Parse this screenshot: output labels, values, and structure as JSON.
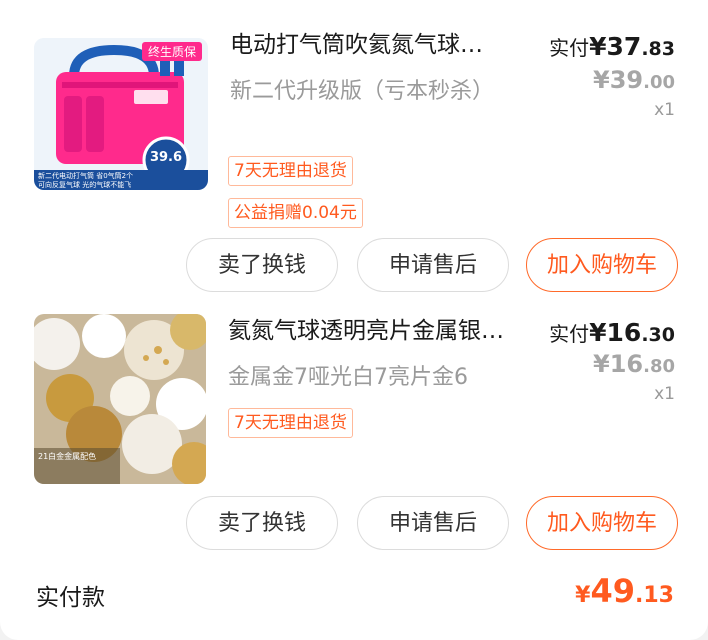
{
  "orders": [
    {
      "title": "电动打气筒吹氦氮气球…",
      "spec": "新二代升级版（亏本秒杀）",
      "tags": [
        "7天无理由退货",
        "公益捐赠0.04元"
      ],
      "paid_label": "实付",
      "paid_yen": "¥37",
      "paid_cent": ".83",
      "orig_yen": "¥39",
      "orig_cent": ".00",
      "qty": "x1",
      "thumb": {
        "badge": "终生质保",
        "price": "39.6",
        "caption_line1": "新二代电动打气筒  省0气筒2个",
        "caption_line2": "可向反复气球  光的气球不能飞"
      },
      "buttons": [
        "卖了换钱",
        "申请售后",
        "加入购物车"
      ]
    },
    {
      "title": "氦氮气球透明亮片金属银…",
      "spec": "金属金7哑光白7亮片金6",
      "tags": [
        "7天无理由退货"
      ],
      "paid_label": "实付",
      "paid_yen": "¥16",
      "paid_cent": ".30",
      "orig_yen": "¥16",
      "orig_cent": ".80",
      "qty": "x1",
      "thumb": {
        "caption": "21白金金属配色"
      },
      "buttons": [
        "卖了换钱",
        "申请售后",
        "加入购物车"
      ]
    }
  ],
  "summary": {
    "label": "实付款",
    "yen": "¥",
    "amount": "49",
    "cent": ".13"
  },
  "colors": {
    "accent": "#ff5a1f",
    "muted": "#9a9a9a",
    "product1_body": "#ff2a8c",
    "product1_handle": "#1f5fb8"
  }
}
